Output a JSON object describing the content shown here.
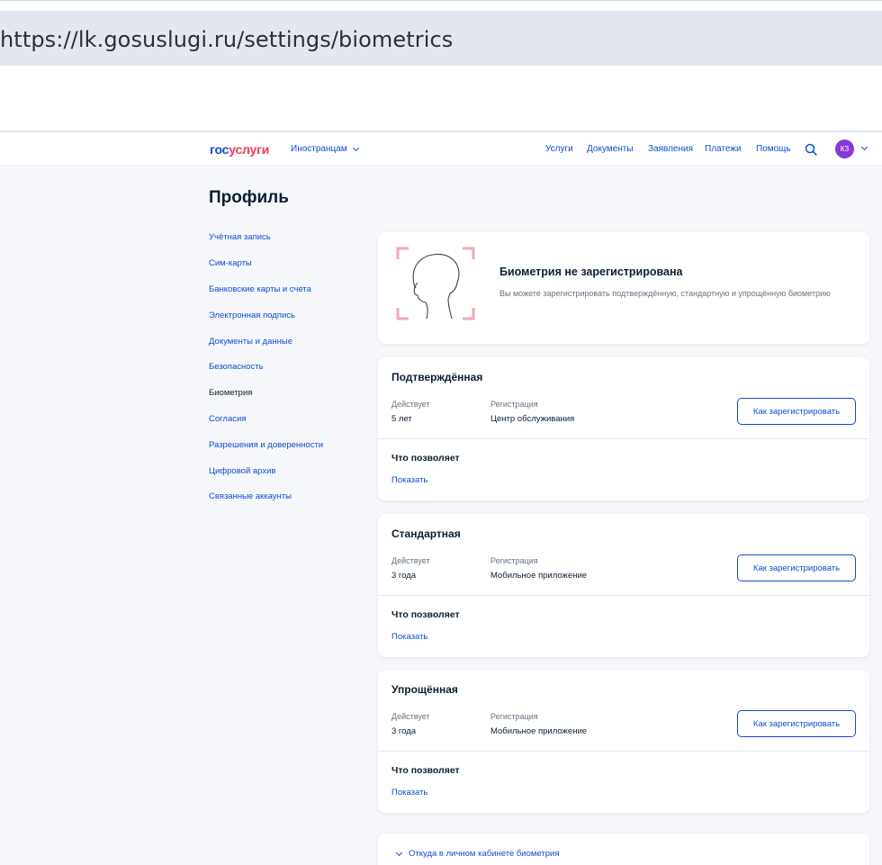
{
  "browser": {
    "url": "https://lk.gosuslugi.ru/settings/biometrics"
  },
  "header": {
    "logo": {
      "part1": "гос",
      "part2": "услуги"
    },
    "foreigners_label": "Иностранцам",
    "nav": [
      "Услуги",
      "Документы",
      "Заявления",
      "Платежи",
      "Помощь"
    ],
    "avatar_initials": "КЗ"
  },
  "page": {
    "title": "Профиль"
  },
  "sidebar": {
    "items": [
      {
        "label": "Учётная запись",
        "active": false
      },
      {
        "label": "Сим-карты",
        "active": false
      },
      {
        "label": "Банковские карты и счета",
        "active": false
      },
      {
        "label": "Электронная подпись",
        "active": false
      },
      {
        "label": "Документы и данные",
        "active": false
      },
      {
        "label": "Безопасность",
        "active": false
      },
      {
        "label": "Биометрия",
        "active": true
      },
      {
        "label": "Согласия",
        "active": false
      },
      {
        "label": "Разрешения и доверенности",
        "active": false
      },
      {
        "label": "Цифровой архив",
        "active": false
      },
      {
        "label": "Связанные аккаунты",
        "active": false
      }
    ]
  },
  "status": {
    "title": "Биометрия не зарегистрирована",
    "description": "Вы можете зарегистрировать подтверждённую, стандартную и упрощённую биометрию"
  },
  "biometry_cards": [
    {
      "title": "Подтверждённая",
      "valid_label": "Действует",
      "valid_value": "5 лет",
      "reg_label": "Регистрация",
      "reg_value": "Центр обслуживания",
      "button": "Как зарегистрировать",
      "allows_title": "Что позволяет",
      "show_link": "Показать"
    },
    {
      "title": "Стандартная",
      "valid_label": "Действует",
      "valid_value": "3 года",
      "reg_label": "Регистрация",
      "reg_value": "Мобильное приложение",
      "button": "Как зарегистрировать",
      "allows_title": "Что позволяет",
      "show_link": "Показать"
    },
    {
      "title": "Упрощённая",
      "valid_label": "Действует",
      "valid_value": "3 года",
      "reg_label": "Регистрация",
      "reg_value": "Мобильное приложение",
      "button": "Как зарегистрировать",
      "allows_title": "Что позволяет",
      "show_link": "Показать"
    }
  ],
  "bottom": {
    "link": "Откуда в личном кабинете биометрия"
  },
  "colors": {
    "primary": "#0d4cd3",
    "brand_red": "#ee3f58",
    "avatar": "#8a37d9",
    "text": "#0b1f33",
    "muted": "#66727f",
    "background": "#f5f7fa"
  },
  "icons": {
    "search": "search-icon",
    "chevron": "chevron-down-icon",
    "face": "face-scan-icon"
  }
}
